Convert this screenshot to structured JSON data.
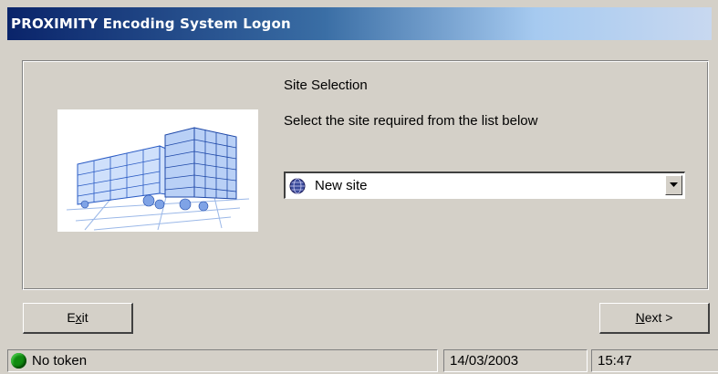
{
  "window": {
    "title": "PROXIMITY Encoding System Logon"
  },
  "site_selection": {
    "heading": "Site Selection",
    "instruction": "Select the site required from the list below",
    "selected_site": "New site",
    "site_icon": "globe-icon",
    "dropdown_icon": "chevron-down-icon"
  },
  "buttons": {
    "exit_pre": "E",
    "exit_accel": "x",
    "exit_post": "it",
    "next_accel": "N",
    "next_post": "ext >"
  },
  "statusbar": {
    "token_status": "No token",
    "token_indicator_color": "#108a10",
    "date": "14/03/2003",
    "time": "15:47"
  },
  "colors": {
    "title_gradient_start": "#0a246a",
    "title_gradient_end": "#a6caf0",
    "face": "#d4d0c8"
  }
}
